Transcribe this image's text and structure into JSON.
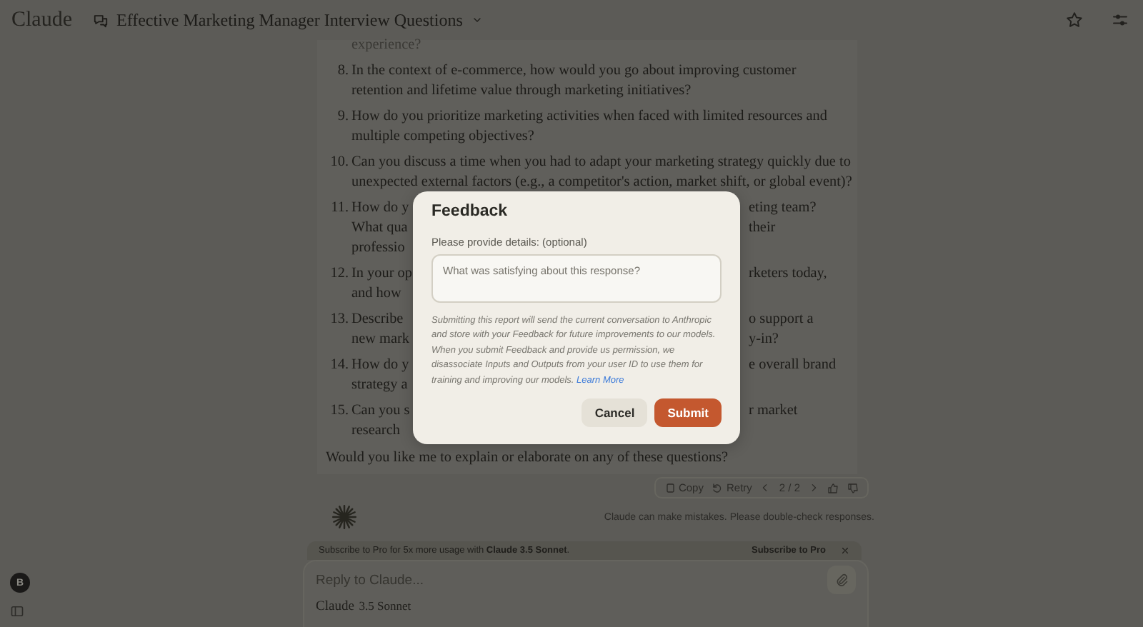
{
  "header": {
    "logo": "Claude",
    "title": "Effective Marketing Manager Interview Questions"
  },
  "message": {
    "continued_line": "experience?",
    "questions": [
      {
        "number": "8.",
        "lines": [
          [
            "In the context of e-commerce, how would you go about improving customer"
          ],
          [
            "retention and lifetime value through marketing initiatives?"
          ]
        ]
      },
      {
        "number": "9.",
        "lines": [
          [
            "How do you prioritize marketing activities when faced with limited resources and"
          ],
          [
            "multiple competing objectives?"
          ]
        ]
      },
      {
        "number": "10.",
        "lines": [
          [
            "Can you discuss a time when you had to adapt your marketing strategy quickly due to"
          ],
          [
            "unexpected external factors (e.g., a competitor's action, market shift, or global event)?"
          ]
        ]
      },
      {
        "number": "11.",
        "lines": [
          [
            "How do y",
            "eting team?"
          ],
          [
            "What qua",
            "their"
          ],
          [
            "professio"
          ]
        ]
      },
      {
        "number": "12.",
        "lines": [
          [
            "In your op",
            "rketers today,"
          ],
          [
            "and how"
          ]
        ]
      },
      {
        "number": "13.",
        "lines": [
          [
            "Describe",
            "o support a"
          ],
          [
            "new mark",
            "y-in?"
          ]
        ]
      },
      {
        "number": "14.",
        "lines": [
          [
            "How do y",
            "e overall brand"
          ],
          [
            "strategy a"
          ]
        ]
      },
      {
        "number": "15.",
        "lines": [
          [
            "Can you s",
            "r market"
          ],
          [
            "research"
          ]
        ]
      }
    ],
    "closing": "Would you like me to explain or elaborate on any of these questions?"
  },
  "actions": {
    "copy": "Copy",
    "retry": "Retry",
    "pager": "2 / 2"
  },
  "note": "Claude can make mistakes. Please double-check responses.",
  "banner": {
    "text": "Subscribe to Pro for 5x more usage with **Claude 3.5 Sonnet**.",
    "link": "Subscribe to Pro"
  },
  "composer": {
    "placeholder": "Reply to Claude...",
    "model_brand": "Claude",
    "model_name": "3.5 Sonnet"
  },
  "user_avatar": "B",
  "modal": {
    "title": "Feedback",
    "label": "Please provide details: (optional)",
    "placeholder": "What was satisfying about this response?",
    "notice": "Submitting this report will send the current conversation to Anthropic and store with your Feedback for future improvements to our models. When you submit Feedback and provide us permission, we disassociate Inputs and Outputs from your user ID to use them for training and improving our models.",
    "link": "Learn More",
    "buttons": [
      {
        "label": "Cancel",
        "kind": "secondary"
      },
      {
        "label": "Submit",
        "kind": "primary"
      }
    ]
  }
}
